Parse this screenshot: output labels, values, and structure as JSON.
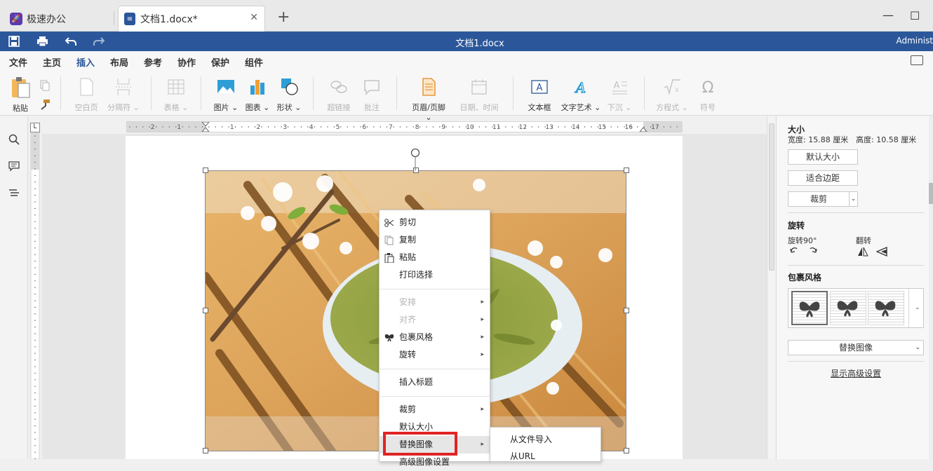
{
  "tabs": {
    "home_label": "极速办公",
    "doc_label": "文档1.docx*",
    "close": "✕",
    "new": "+"
  },
  "window": {
    "minimize": "—",
    "maximize": "☐"
  },
  "titlebar": {
    "title": "文档1.docx",
    "user": "Administ"
  },
  "menu": {
    "items": [
      "文件",
      "主页",
      "插入",
      "布局",
      "参考",
      "协作",
      "保护",
      "组件"
    ],
    "active": "插入"
  },
  "ribbon": {
    "paste": "粘贴",
    "blank_page": "空白页",
    "page_break": "分隔符",
    "table": "表格",
    "image": "图片",
    "chart": "图表",
    "shape": "形状",
    "hyperlink": "超链接",
    "comment": "批注",
    "header_footer": "页眉/页脚",
    "date_time": "日期、时间",
    "textbox": "文本框",
    "text_art": "文字艺术",
    "dropcap": "下沉",
    "equation": "方程式",
    "symbol": "符号"
  },
  "ruler": {
    "corner": "L",
    "labels": [
      "2",
      "1",
      "1",
      "2",
      "3",
      "4",
      "5",
      "6",
      "7",
      "8",
      "9",
      "10",
      "11",
      "12",
      "13",
      "14",
      "15",
      "16",
      "17"
    ]
  },
  "context_menu": {
    "cut": "剪切",
    "copy": "复制",
    "paste": "粘贴",
    "print_selection": "打印选择",
    "arrange": "安排",
    "align": "对齐",
    "wrap_style": "包裹风格",
    "rotate": "旋转",
    "insert_caption": "插入标题",
    "crop": "裁剪",
    "default_size": "默认大小",
    "replace_image": "替换图像",
    "advanced": "高级图像设置",
    "arrow": "▸"
  },
  "submenu": {
    "from_file": "从文件导入",
    "from_url": "从URL"
  },
  "right_panel": {
    "size_title": "大小",
    "width_text": "宽度: 15.88 厘米",
    "height_text": "高度: 10.58 厘米",
    "default_size_btn": "默认大小",
    "fit_margin_btn": "适合边距",
    "crop_btn": "裁剪",
    "rotate_title": "旋转",
    "rotate90": "旋转90°",
    "flip": "翻转",
    "wrap_title": "包裹风格",
    "replace_select": "替换图像",
    "advanced_link": "显示高级设置"
  },
  "colors": {
    "accent": "#2b579a",
    "highlight_box": "#e02424"
  }
}
